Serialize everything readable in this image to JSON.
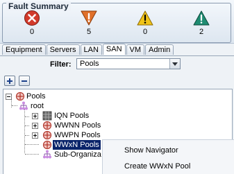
{
  "fault_summary": {
    "title": "Fault Summary",
    "items": [
      {
        "icon": "critical-icon",
        "count": "0",
        "color": "#d23a2b"
      },
      {
        "icon": "major-icon",
        "count": "5",
        "color": "#e0702a"
      },
      {
        "icon": "minor-icon",
        "count": "0",
        "color": "#f0c419"
      },
      {
        "icon": "warning-icon",
        "count": "2",
        "color": "#1f8c72"
      }
    ]
  },
  "tabs": [
    "Equipment",
    "Servers",
    "LAN",
    "SAN",
    "VM",
    "Admin"
  ],
  "active_tab": "SAN",
  "filter": {
    "label": "Filter:",
    "value": "Pools"
  },
  "tree": {
    "pools": "Pools",
    "root": "root",
    "iqn": "IQN Pools",
    "wwnn": "WWNN Pools",
    "wwpn": "WWPN Pools",
    "wwxn": "WWxN Pools",
    "sub_org": "Sub-Organiza"
  },
  "context_menu": {
    "show_navigator": "Show Navigator",
    "create_wwxn_pool": "Create WWxN Pool"
  }
}
